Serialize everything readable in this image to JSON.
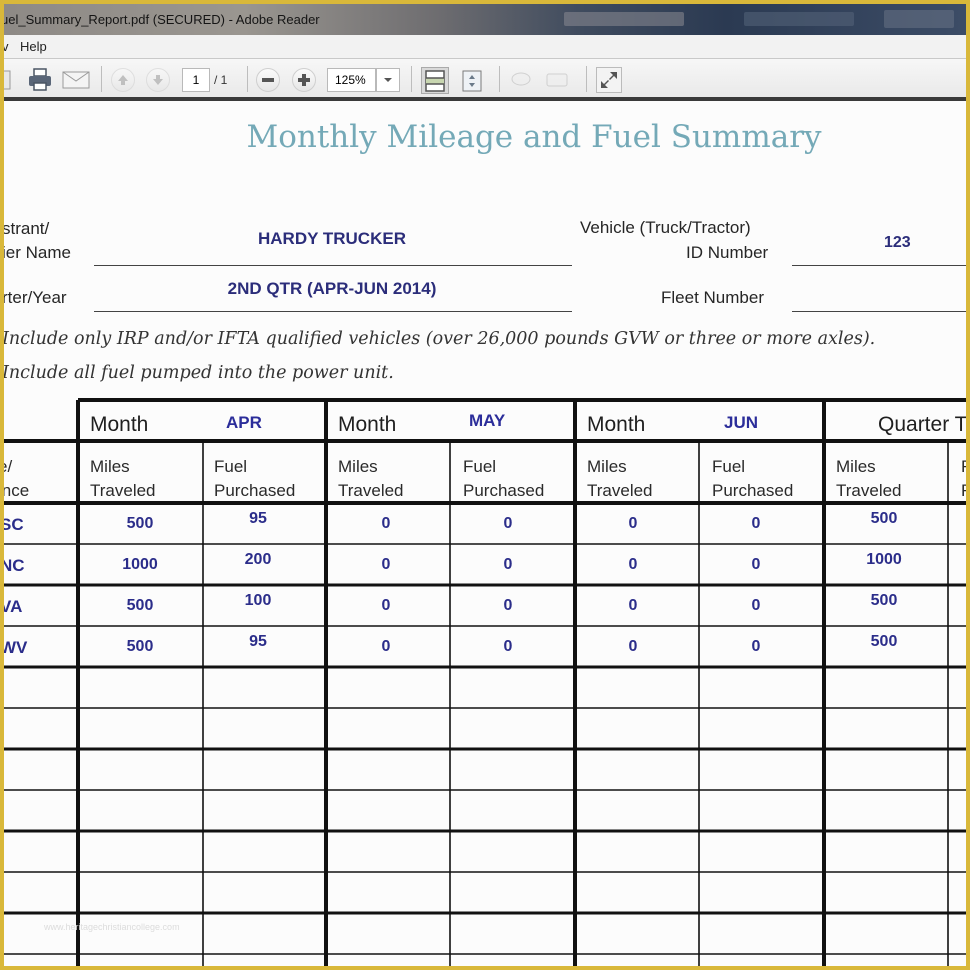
{
  "window": {
    "title": "uel_Summary_Report.pdf (SECURED) - Adobe Reader"
  },
  "menu": {
    "partial_item": "v",
    "help": "Help"
  },
  "toolbar": {
    "page_current": "1",
    "page_total": "/ 1",
    "zoom_value": "125%",
    "icons": [
      "save-icon",
      "print-icon",
      "email-icon",
      "previous-page-icon",
      "next-page-icon",
      "zoom-out-icon",
      "zoom-in-icon",
      "fit-page-icon",
      "fit-width-icon",
      "comment-icon",
      "share-icon",
      "full-screen-icon"
    ]
  },
  "document": {
    "title": "Monthly Mileage and Fuel Summary",
    "registrant_label_line1": "strant/",
    "registrant_label_line2": "ier Name",
    "registrant_value": "HARDY TRUCKER",
    "quarter_label": "rter/Year",
    "quarter_value": "2ND QTR (APR-JUN 2014)",
    "vehicle_label_line1": "Vehicle (Truck/Tractor)",
    "vehicle_label_line2": "ID Number",
    "vehicle_value": "123",
    "fleet_label": "Fleet Number",
    "fleet_value": "",
    "note1": "Include only IRP and/or IFTA qualified vehicles (over 26,000 pounds GVW or three or more axles).",
    "note2": "Include all fuel pumped into the power unit."
  },
  "table": {
    "jurisdiction_header_line1": "e/",
    "jurisdiction_header_line2": "ince",
    "month_label": "Month",
    "months": [
      "APR",
      "MAY",
      "JUN"
    ],
    "quarter_header": "Quarter T",
    "miles_line1": "Miles",
    "miles_line2": "Traveled",
    "fuel_line1": "Fuel",
    "fuel_line2": "Purchased",
    "quarter_fuel_partial1": "F",
    "quarter_fuel_partial2": "F",
    "rows": [
      {
        "state": "SC",
        "apr_miles": "500",
        "apr_fuel": "95",
        "may_miles": "0",
        "may_fuel": "0",
        "jun_miles": "0",
        "jun_fuel": "0",
        "qtr_miles": "500"
      },
      {
        "state": "NC",
        "apr_miles": "1000",
        "apr_fuel": "200",
        "may_miles": "0",
        "may_fuel": "0",
        "jun_miles": "0",
        "jun_fuel": "0",
        "qtr_miles": "1000"
      },
      {
        "state": "VA",
        "apr_miles": "500",
        "apr_fuel": "100",
        "may_miles": "0",
        "may_fuel": "0",
        "jun_miles": "0",
        "jun_fuel": "0",
        "qtr_miles": "500"
      },
      {
        "state": "WV",
        "apr_miles": "500",
        "apr_fuel": "95",
        "may_miles": "0",
        "may_fuel": "0",
        "jun_miles": "0",
        "jun_fuel": "0",
        "qtr_miles": "500"
      }
    ],
    "empty_rows": 7
  },
  "watermark": "www.heritagechristiancollege.com"
}
